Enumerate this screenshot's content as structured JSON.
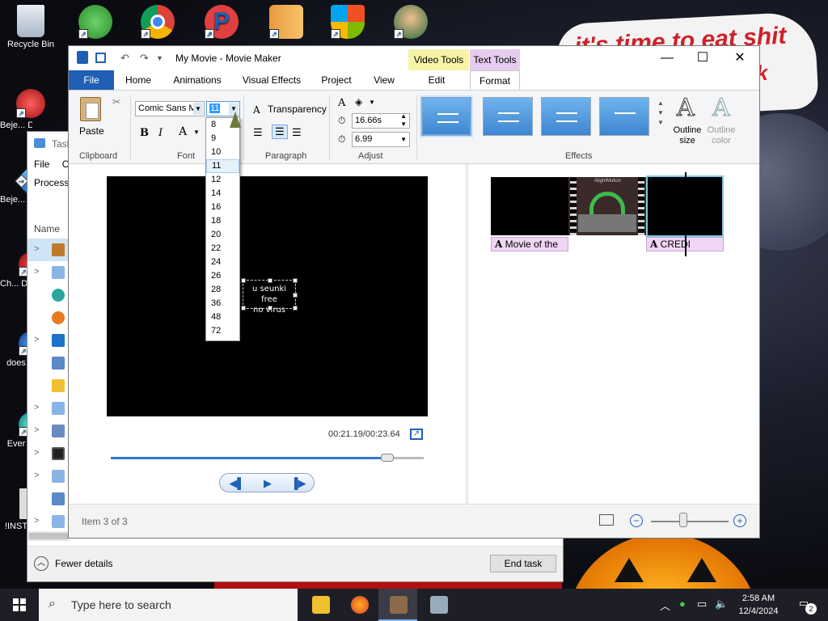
{
  "desktop": {
    "icons": [
      {
        "label": "Recycle Bin"
      },
      {
        "label": "Beje... De..."
      },
      {
        "label": "Beje... De"
      },
      {
        "label": "Ch... De"
      },
      {
        "label": "does"
      },
      {
        "label": "Ever"
      },
      {
        "label": "!INST"
      }
    ],
    "wallpaper_text_1": "it's time to eat shit",
    "wallpaper_text_2": "ck"
  },
  "taskmanager": {
    "title": "Task",
    "menu": [
      "File",
      "Op"
    ],
    "tab": "Processe",
    "column_name": "Name",
    "fewer_details": "Fewer details",
    "end_task": "End task"
  },
  "moviemaker": {
    "title": "My Movie - Movie Maker",
    "context_video": "Video Tools",
    "context_text": "Text Tools",
    "tabs": [
      "File",
      "Home",
      "Animations",
      "Visual Effects",
      "Project",
      "View",
      "Edit",
      "Format"
    ],
    "ribbon": {
      "clipboard_label": "Clipboard",
      "paste": "Paste",
      "font_label": "Font",
      "font_name": "Comic Sans M",
      "font_size": "11",
      "paragraph_label": "Paragraph",
      "transparency": "Transparency",
      "adjust_label": "Adjust",
      "start_time": "16.66s",
      "duration": "6.99",
      "effects_label": "Effects",
      "outline_size": "Outline size",
      "outline_color": "Outline color"
    },
    "font_sizes": [
      "8",
      "9",
      "10",
      "11",
      "12",
      "14",
      "16",
      "18",
      "20",
      "22",
      "24",
      "26",
      "28",
      "36",
      "48",
      "72"
    ],
    "font_size_highlighted": "11",
    "preview_caption_line1": "u seunki free",
    "preview_caption_line2": "no virus",
    "timecode": "00:21.19/00:23.64",
    "seek_fraction": 0.88,
    "storyboard": {
      "caption_1": "Movie of the",
      "caption_2": "CREDI",
      "clip_text": "AlightMotion"
    },
    "status": "Item 3 of 3"
  },
  "taskbar": {
    "search_placeholder": "Type here to search",
    "time": "2:58 AM",
    "date": "12/4/2024",
    "notification_count": "2"
  }
}
